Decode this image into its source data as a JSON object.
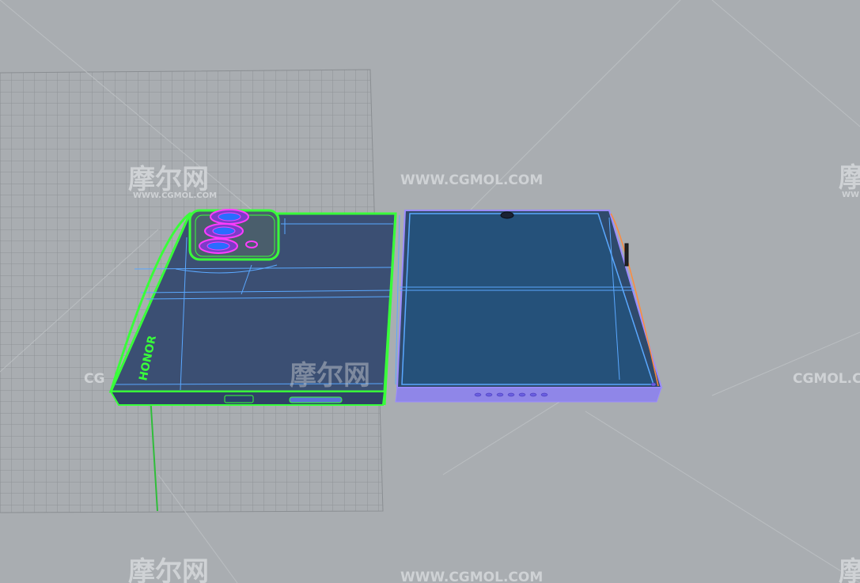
{
  "viewport": {
    "background": "#a9adb1",
    "grid_color": "#8e9296",
    "axis_color": "#2fbd3a",
    "selection_color": "#39ff3a",
    "surface_color": "#3b4f73",
    "inner_screen_color": "#25517a",
    "wire_color": "#5aa8ff",
    "back_edge_color": "#9b8cff"
  },
  "watermarks": {
    "cn_top_left": "摩尔网",
    "cn_top_left_sub": "WWW.CGMOL.COM",
    "url_top_center": "WWW.CGMOL.COM",
    "cn_top_right": "摩",
    "cn_top_right_sub": "WW",
    "mid_left": "CG",
    "cn_middle": "摩尔网",
    "mid_right": "CGMOL.COM",
    "cn_bottom_left": "摩尔网",
    "url_bottom_center": "WWW.CGMOL.COM",
    "cn_bottom_right": "摩"
  },
  "model": {
    "brand_label": "HONOR",
    "camera_lens_icon": "camera-lens-icon",
    "flash_icon": "flash-icon",
    "earpiece_icon": "notch-camera-icon"
  }
}
